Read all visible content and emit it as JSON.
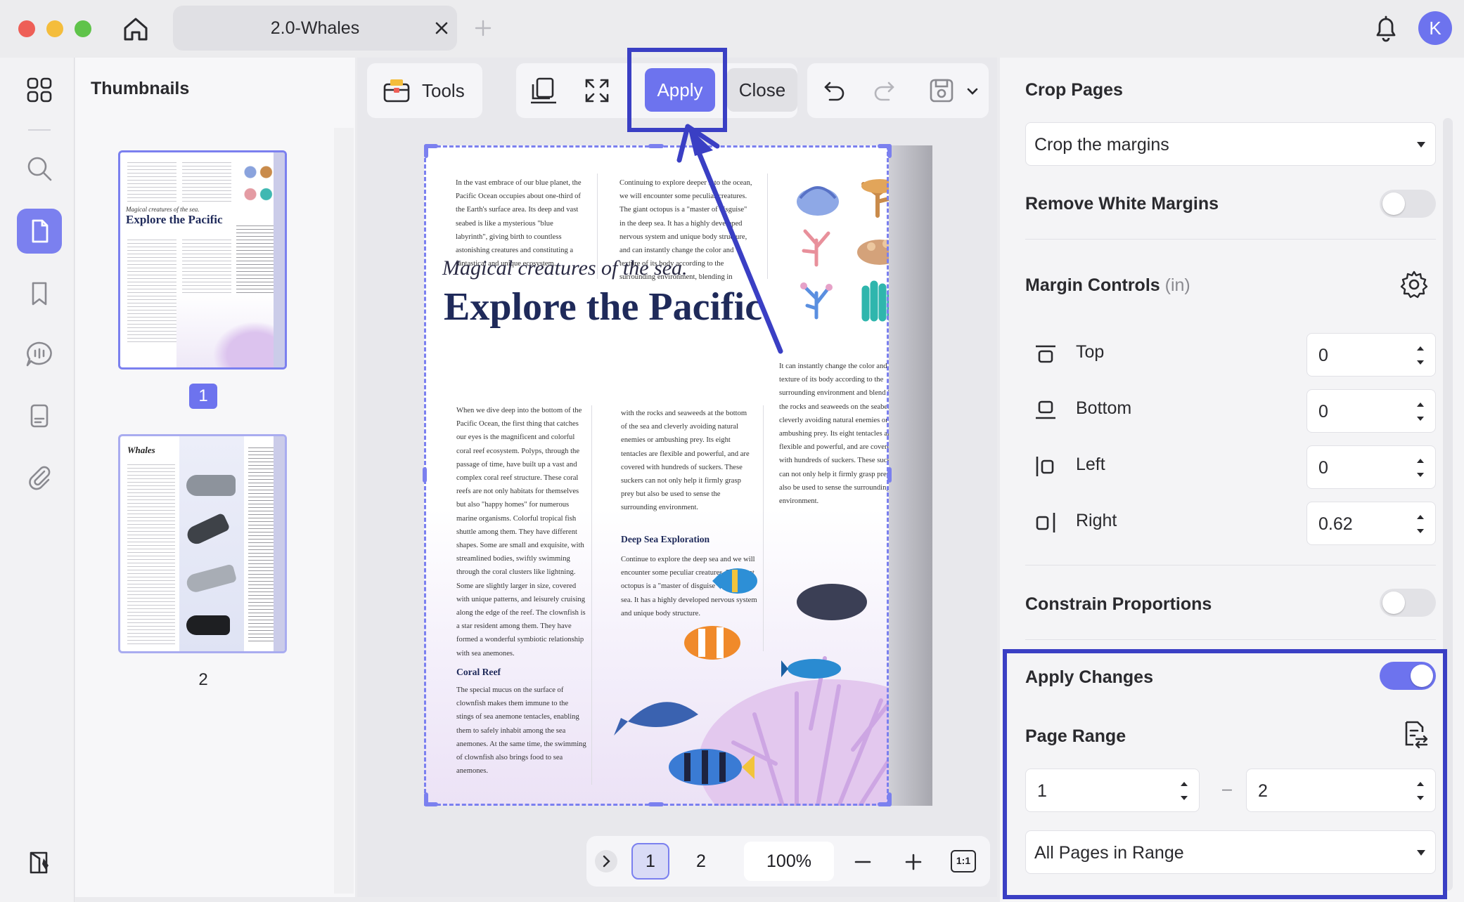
{
  "window": {
    "tab_title": "2.0-Whales",
    "avatar_initial": "K"
  },
  "colors": {
    "accent": "#6d73ee",
    "highlight": "#3a3fc4",
    "badge_avatar": "#6d73ee"
  },
  "sidebar": {
    "title": "Thumbnails",
    "pages": [
      {
        "label": "1",
        "selected": true
      },
      {
        "label": "2",
        "selected": false
      }
    ]
  },
  "toolbar": {
    "tools_label": "Tools",
    "apply_label": "Apply",
    "close_label": "Close"
  },
  "document": {
    "subtitle": "Magical creatures of the sea.",
    "title": "Explore the Pacific",
    "col1_top": "In the vast embrace of our blue planet, the Pacific Ocean occupies about one-third of the Earth's surface area. Its deep and vast seabed is like a mysterious \"blue labyrinth\", giving birth to countless astonishing creatures and constituting a fantastical and unique ecosystem.",
    "col2_top": "Continuing to explore deeper into the ocean, we will encounter some peculiar creatures. The giant octopus is a \"master of disguise\" in the deep sea. It has a highly developed nervous system and unique body structure, and can instantly change the color and texture of its body according to the surrounding environment, blending in",
    "col3_mid": "It can instantly change the color and texture of its body according to the surrounding environment and blend in with the rocks and seaweeds on the seabed, cleverly avoiding natural enemies or ambushing prey. Its eight tentacles are flexible and powerful, and are covered with hundreds of suckers. These suckers can not only help it firmly grasp prey but also be used to sense the surrounding environment.",
    "col1_mid": "When we dive deep into the bottom of the Pacific Ocean, the first thing that catches our eyes is the magnificent and colorful coral reef ecosystem. Polyps, through the passage of time, have built up a vast and complex coral reef structure. These coral reefs are not only habitats for themselves but also \"happy homes\" for numerous marine organisms. Colorful tropical fish shuttle among them. They have different shapes. Some are small and exquisite, with streamlined bodies, swiftly swimming through the coral clusters like lightning. Some are slightly larger in size, covered with unique patterns, and leisurely cruising along the edge of the reef. The clownfish is a star resident among them. They have formed a wonderful symbiotic relationship with sea anemones.",
    "col2_mid": "with the rocks and seaweeds at the bottom of the sea and cleverly avoiding natural enemies or ambushing prey. Its eight tentacles are flexible and powerful, and are covered with hundreds of suckers. These suckers can not only help it firmly grasp prey but also be used to sense the surrounding environment.",
    "deep_sea_heading": "Deep Sea Exploration",
    "deep_sea_text": "Continue to explore the deep sea and we will encounter some peculiar creatures. The giant octopus is a \"master of disguise\" in the deep sea. It has a highly developed nervous system and unique body structure.",
    "coral_heading": "Coral Reef",
    "coral_text": "The special mucus on the surface of clownfish makes them immune to the stings of sea anemone tentacles, enabling them to safely inhabit among the sea anemones. At the same time, the swimming of clownfish also brings food to sea anemones.",
    "thumb2_title": "Whales"
  },
  "pager": {
    "pages": [
      "1",
      "2"
    ],
    "current": "1",
    "zoom": "100%",
    "fit_label": "1:1"
  },
  "panel": {
    "title": "Crop Pages",
    "crop_mode": "Crop the margins",
    "remove_white_margins": "Remove White Margins",
    "margin_controls": "Margin Controls",
    "margin_unit": "(in)",
    "margins": [
      {
        "label": "Top",
        "value": "0"
      },
      {
        "label": "Bottom",
        "value": "0"
      },
      {
        "label": "Left",
        "value": "0"
      },
      {
        "label": "Right",
        "value": "0.62"
      }
    ],
    "constrain_proportions": "Constrain Proportions",
    "apply_changes": "Apply Changes",
    "apply_changes_on": true,
    "page_range": "Page Range",
    "range_from": "1",
    "range_to": "2",
    "range_separator": "–",
    "range_mode": "All Pages in Range"
  }
}
